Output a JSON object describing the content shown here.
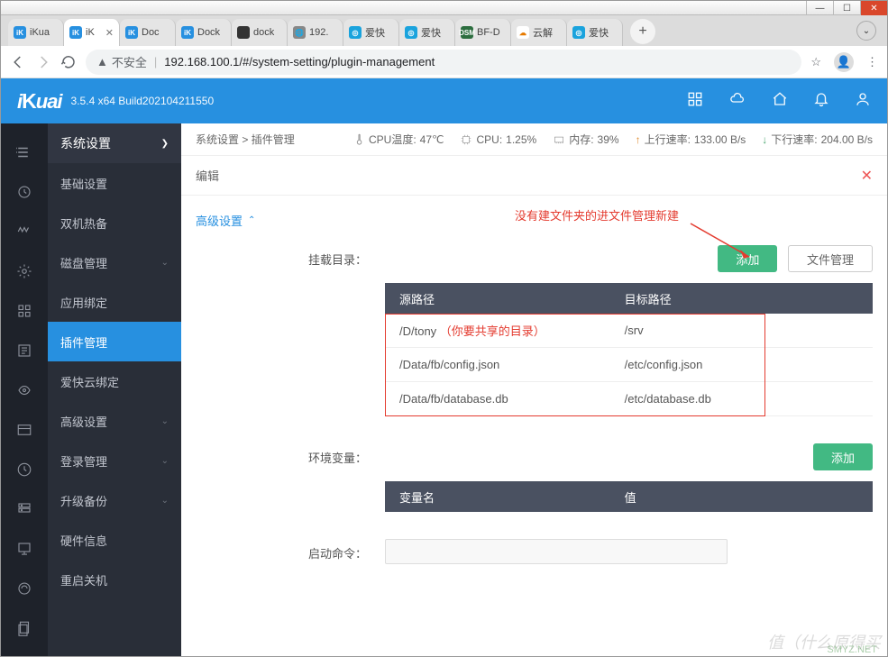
{
  "browser": {
    "tabs": [
      {
        "label": "iKua",
        "fav_bg": "#2790e0",
        "fav_text": "iK"
      },
      {
        "label": "iK",
        "fav_bg": "#2790e0",
        "fav_text": "iK",
        "active": true,
        "closeable": true
      },
      {
        "label": "Doc",
        "fav_bg": "#2790e0",
        "fav_text": "iK"
      },
      {
        "label": "Dock",
        "fav_bg": "#2790e0",
        "fav_text": "iK"
      },
      {
        "label": "dock",
        "fav_bg": "#333",
        "fav_text": ""
      },
      {
        "label": "192.",
        "fav_bg": "#888",
        "fav_text": "🌐"
      },
      {
        "label": "爱快",
        "fav_bg": "#1aa3dd",
        "fav_text": "◎"
      },
      {
        "label": "爱快",
        "fav_bg": "#1aa3dd",
        "fav_text": "◎"
      },
      {
        "label": "BF-D",
        "fav_bg": "#2c6e3f",
        "fav_text": "DSM"
      },
      {
        "label": "云解",
        "fav_bg": "#fff",
        "fav_text": "☁"
      },
      {
        "label": "爱快",
        "fav_bg": "#1aa3dd",
        "fav_text": "◎"
      }
    ],
    "url_warn": "不安全",
    "url": "192.168.100.1/#/system-setting/plugin-management"
  },
  "header": {
    "logo": "iKuai",
    "version": "3.5.4 x64 Build202104211550"
  },
  "sidebar": {
    "head": "系统设置",
    "items": [
      {
        "label": "基础设置",
        "chev": false
      },
      {
        "label": "双机热备",
        "chev": false
      },
      {
        "label": "磁盘管理",
        "chev": true
      },
      {
        "label": "应用绑定",
        "chev": false
      },
      {
        "label": "插件管理",
        "chev": false,
        "active": true
      },
      {
        "label": "爱快云绑定",
        "chev": false
      },
      {
        "label": "高级设置",
        "chev": true
      },
      {
        "label": "登录管理",
        "chev": true
      },
      {
        "label": "升级备份",
        "chev": true
      },
      {
        "label": "硬件信息",
        "chev": false
      },
      {
        "label": "重启关机",
        "chev": false
      }
    ]
  },
  "status": {
    "breadcrumb1": "系统设置",
    "breadcrumb2": "插件管理",
    "cpu_temp_label": "CPU温度:",
    "cpu_temp": "47℃",
    "cpu_label": "CPU:",
    "cpu": "1.25%",
    "mem_label": "内存:",
    "mem": "39%",
    "up_label": "上行速率:",
    "up": "133.00 B/s",
    "down_label": "下行速率:",
    "down": "204.00 B/s"
  },
  "page": {
    "edit_title": "编辑",
    "section_advanced": "高级设置",
    "annotation": "没有建文件夹的进文件管理新建",
    "mount_label": "挂载目录：",
    "btn_add": "添加",
    "btn_filemgr": "文件管理",
    "mount_head_src": "源路径",
    "mount_head_dst": "目标路径",
    "mount_rows": [
      {
        "src": "/D/tony",
        "src_note": "（你要共享的目录）",
        "dst": "/srv"
      },
      {
        "src": "/Data/fb/config.json",
        "dst": "/etc/config.json"
      },
      {
        "src": "/Data/fb/database.db",
        "dst": "/etc/database.db"
      }
    ],
    "env_label": "环境变量：",
    "env_head_name": "变量名",
    "env_head_val": "值",
    "cmd_label": "启动命令：",
    "cmd_value": ""
  },
  "watermark": "值（什么原得买",
  "watermark2": "SMYZ.NET"
}
